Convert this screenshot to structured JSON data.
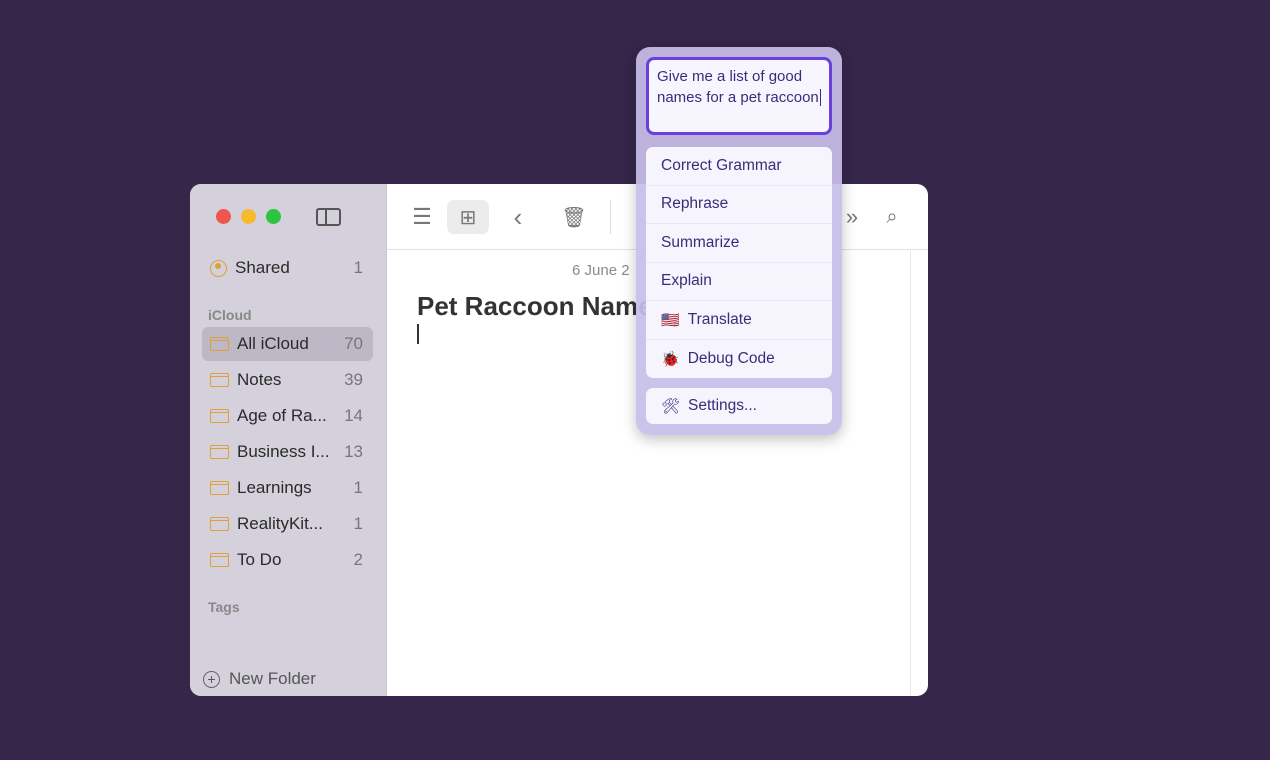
{
  "sidebar": {
    "shared": {
      "label": "Shared",
      "count": "1"
    },
    "icloud_header": "iCloud",
    "folders": [
      {
        "label": "All iCloud",
        "count": "70",
        "selected": true
      },
      {
        "label": "Notes",
        "count": "39"
      },
      {
        "label": "Age of Ra...",
        "count": "14"
      },
      {
        "label": "Business I...",
        "count": "13"
      },
      {
        "label": "Learnings",
        "count": "1"
      },
      {
        "label": "RealityKit...",
        "count": "1"
      },
      {
        "label": "To Do",
        "count": "2"
      }
    ],
    "tags_header": "Tags",
    "new_folder": "New Folder"
  },
  "note": {
    "date": "6 June 2",
    "title": "Pet Raccoon Name"
  },
  "popup": {
    "prompt": "Give me a list of good names for a pet raccoon",
    "items": [
      {
        "label": "Correct Grammar",
        "icon": ""
      },
      {
        "label": "Rephrase",
        "icon": ""
      },
      {
        "label": "Summarize",
        "icon": ""
      },
      {
        "label": "Explain",
        "icon": ""
      },
      {
        "label": "Translate",
        "icon": "🇺🇸"
      },
      {
        "label": "Debug Code",
        "icon": "🐞"
      }
    ],
    "settings": {
      "label": "Settings...",
      "icon": "🛠"
    }
  },
  "colors": {
    "background": "#35264a",
    "accent": "#6b3ee0",
    "folder": "#e0a132"
  }
}
